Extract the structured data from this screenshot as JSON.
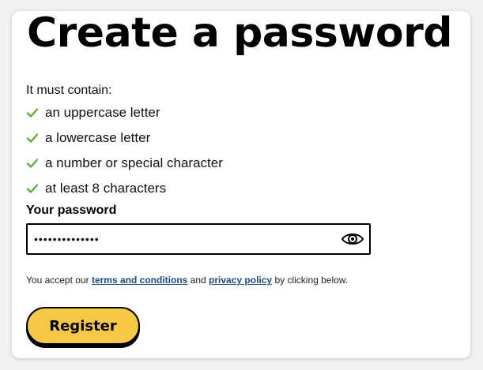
{
  "page": {
    "title": "Create a password",
    "intro": "It must contain:"
  },
  "requirements": [
    {
      "label": "an uppercase letter",
      "met": true,
      "icon": "check-icon"
    },
    {
      "label": "a lowercase letter",
      "met": true,
      "icon": "check-icon"
    },
    {
      "label": "a number or special character",
      "met": true,
      "icon": "check-icon"
    },
    {
      "label": "at least 8 characters",
      "met": true,
      "icon": "check-icon"
    }
  ],
  "password": {
    "label": "Your password",
    "value": "••••••••••••••",
    "toggle_icon": "eye-icon"
  },
  "terms": {
    "prefix": "You accept our",
    "terms_link": "terms and conditions",
    "middle": "and",
    "privacy_link": "privacy policy",
    "suffix": "by clicking below."
  },
  "actions": {
    "register_label": "Register"
  },
  "colors": {
    "check": "#5bb434",
    "button": "#f7c846",
    "link": "#1a4a8a"
  }
}
